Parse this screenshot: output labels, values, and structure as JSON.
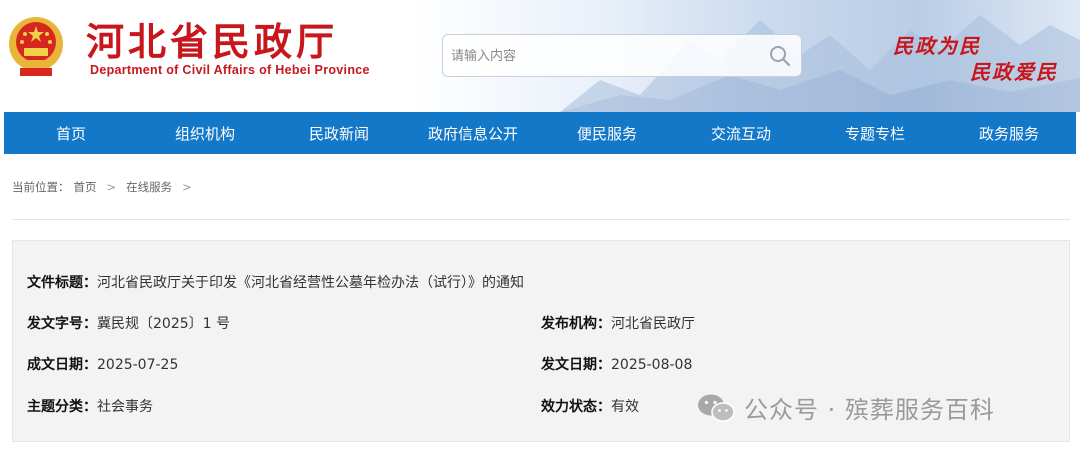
{
  "header": {
    "site_title": "河北省民政厅",
    "site_subtitle": "Department of Civil Affairs of Hebei Province",
    "emblem_icon": "national-emblem-icon",
    "slogan_line1": "民政为民",
    "slogan_line2": "民政爱民",
    "brand_color": "#c8161d"
  },
  "search": {
    "placeholder": "请输入内容",
    "value": "",
    "icon": "search-icon"
  },
  "nav": {
    "background": "#1478c8",
    "items": [
      "首页",
      "组织机构",
      "民政新闻",
      "政府信息公开",
      "便民服务",
      "交流互动",
      "专题专栏",
      "政务服务"
    ]
  },
  "breadcrumb": {
    "prefix": "当前位置：",
    "items": [
      "首页",
      "在线服务"
    ],
    "separator": ">"
  },
  "document": {
    "title_label": "文件标题：",
    "title_value": "河北省民政厅关于印发《河北省经营性公墓年检办法（试行）》的通知",
    "doc_no_label": "发文字号：",
    "doc_no_value": "冀民规〔2025〕1 号",
    "issuer_label": "发布机构：",
    "issuer_value": "河北省民政厅",
    "created_label": "成文日期：",
    "created_value": "2025-07-25",
    "issued_label": "发文日期：",
    "issued_value": "2025-08-08",
    "topic_label": "主题分类：",
    "topic_value": "社会事务",
    "status_label": "效力状态：",
    "status_value": "有效"
  },
  "watermark": {
    "text": "公众号 · 殡葬服务百科",
    "icon": "wechat-icon"
  }
}
